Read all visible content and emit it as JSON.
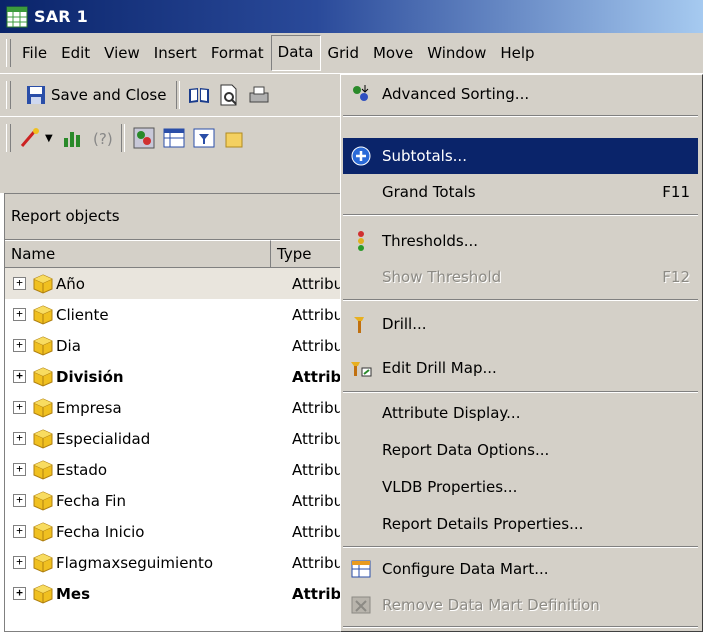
{
  "window": {
    "title": "SAR 1"
  },
  "menubar": [
    "File",
    "Edit",
    "View",
    "Insert",
    "Format",
    "Data",
    "Grid",
    "Move",
    "Window",
    "Help"
  ],
  "toolbar": {
    "save_close": "Save and Close"
  },
  "panel": {
    "title": "Report objects",
    "columns": [
      "Name",
      "Type"
    ],
    "rows": [
      {
        "name": "Año",
        "type": "Attribu",
        "bold": false
      },
      {
        "name": "Cliente",
        "type": "Attribu",
        "bold": false
      },
      {
        "name": "Dia",
        "type": "Attribu",
        "bold": false
      },
      {
        "name": "División",
        "type": "Attrib",
        "bold": true
      },
      {
        "name": "Empresa",
        "type": "Attribu",
        "bold": false
      },
      {
        "name": "Especialidad",
        "type": "Attribu",
        "bold": false
      },
      {
        "name": "Estado",
        "type": "Attribu",
        "bold": false
      },
      {
        "name": "Fecha Fin",
        "type": "Attribu",
        "bold": false
      },
      {
        "name": "Fecha Inicio",
        "type": "Attribu",
        "bold": false
      },
      {
        "name": "Flagmaxseguimiento",
        "type": "Attribu",
        "bold": false
      },
      {
        "name": "Mes",
        "type": "Attrib",
        "bold": true
      }
    ]
  },
  "data_menu": {
    "advanced_sorting": "Advanced Sorting...",
    "subtotals": "Subtotals...",
    "grand_totals": "Grand Totals",
    "grand_totals_key": "F11",
    "thresholds": "Thresholds...",
    "show_threshold": "Show Threshold",
    "show_threshold_key": "F12",
    "drill": "Drill...",
    "edit_drill_map": "Edit Drill Map...",
    "attribute_display": "Attribute Display...",
    "report_data_options": "Report Data Options...",
    "vldb_properties": "VLDB Properties...",
    "report_details_properties": "Report Details Properties...",
    "configure_data_mart": "Configure Data Mart...",
    "remove_data_mart_definition": "Remove Data Mart Definition"
  },
  "colors": {
    "highlight": "#0a246a",
    "face": "#d4d0c8",
    "cube": "#f0c020"
  }
}
